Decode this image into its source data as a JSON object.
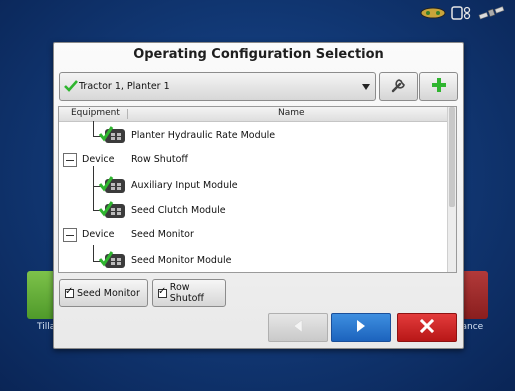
{
  "dialog": {
    "title": "Operating Configuration Selection",
    "selected_config": "Tractor 1, Planter 1"
  },
  "tree": {
    "columns": [
      "Equipment",
      "Name"
    ],
    "rows": [
      {
        "type": "module",
        "label": "Planter Hydraulic Rate Module",
        "status": "ok"
      },
      {
        "type": "device",
        "kind": "Device",
        "label": "Row Shutoff"
      },
      {
        "type": "module",
        "label": "Auxiliary Input Module",
        "status": "ok"
      },
      {
        "type": "module",
        "label": "Seed Clutch Module",
        "status": "ok"
      },
      {
        "type": "device",
        "kind": "Device",
        "label": "Seed Monitor"
      },
      {
        "type": "module",
        "label": "Seed Monitor Module",
        "status": "ok"
      }
    ]
  },
  "toggles": {
    "seed_monitor": {
      "label": "Seed Monitor",
      "checked": true
    },
    "row_shutoff": {
      "label": "Row Shutoff",
      "checked": true
    }
  },
  "background": {
    "left_tile_label": "Tilla",
    "right_tile_label": "lance"
  },
  "colors": {
    "accent_green": "#2fb52f",
    "next_blue": "#2a78d3",
    "cancel_red": "#cc2222"
  },
  "icons": [
    "wrench-icon",
    "add-icon",
    "back-arrow-icon",
    "next-arrow-icon",
    "close-icon",
    "gps-icon",
    "display-icon",
    "satellite-icon"
  ]
}
